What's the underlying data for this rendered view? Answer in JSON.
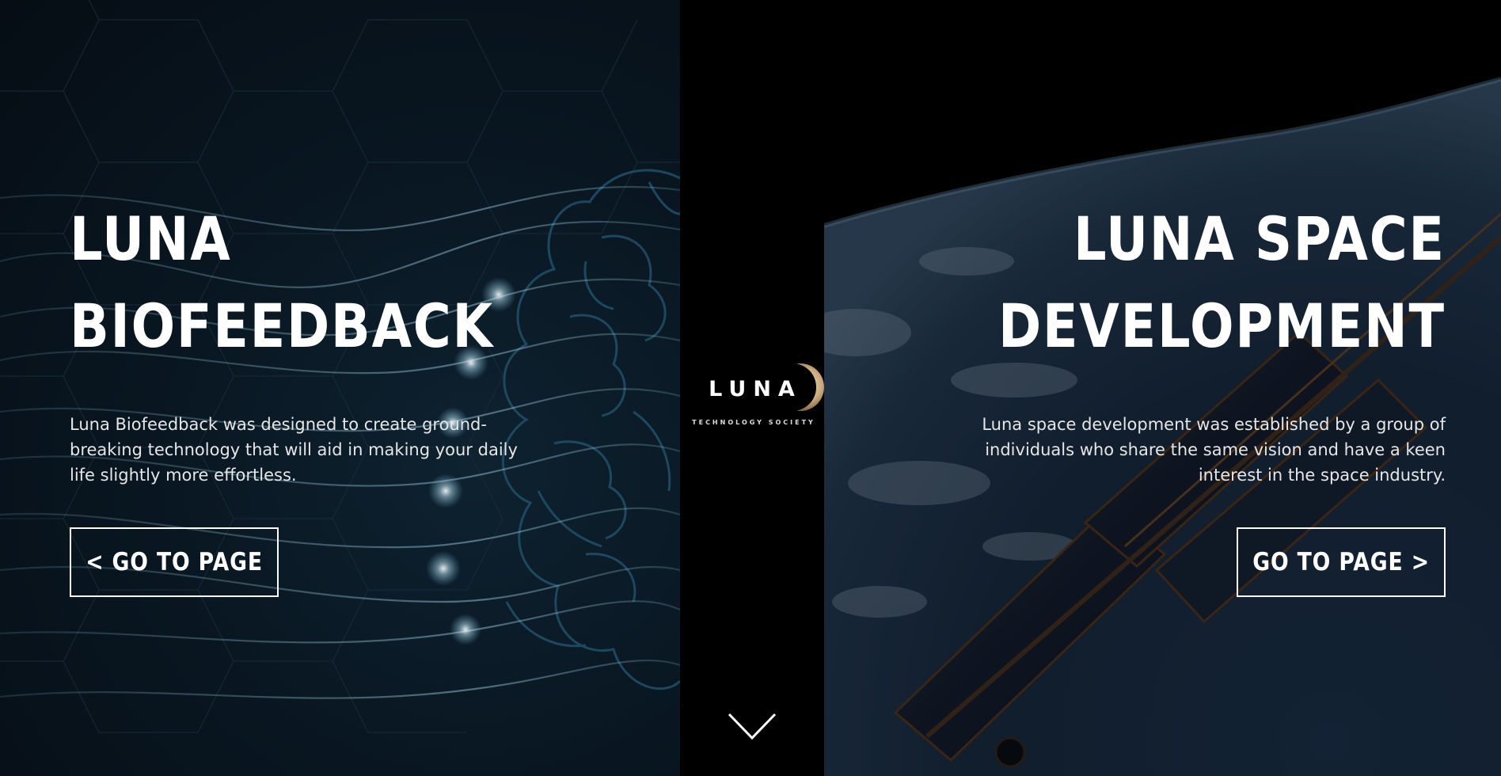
{
  "left_panel": {
    "title_line1": "LUNA",
    "title_line2": "BIOFEEDBACK",
    "description": "Luna Biofeedback was designed to create ground-breaking technology that will aid in making your daily life slightly more effortless.",
    "button_label": "< GO TO PAGE"
  },
  "logo": {
    "wordmark": "LUNA",
    "tagline": "TECHNOLOGY SOCIETY",
    "icon": "crescent-moon-icon"
  },
  "center": {
    "scroll_icon": "chevron-down-icon"
  },
  "right_panel": {
    "title_line1": "LUNA SPACE",
    "title_line2": "DEVELOPMENT",
    "description": "Luna space development was established by a group of individuals who share the same vision and have a keen interest in the space industry.",
    "button_label": "GO TO PAGE >"
  },
  "colors": {
    "left_bg": "#091722",
    "center_bg": "#000000",
    "right_bg": "#000000",
    "text": "#ffffff",
    "glow": "#9fd3ec"
  }
}
